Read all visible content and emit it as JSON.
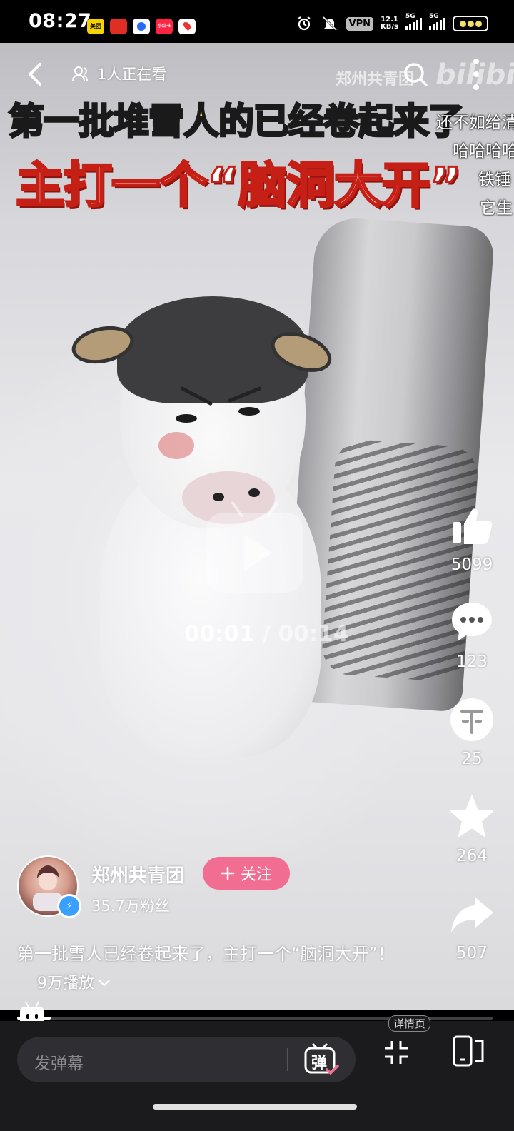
{
  "status_bar": {
    "time": "08:27",
    "app_icons": [
      {
        "name": "meituan-icon",
        "color": "#f5d300",
        "label": "美团"
      },
      {
        "name": "pinduoduo-icon",
        "color": "#e02e24",
        "label": ""
      },
      {
        "name": "browser-icon",
        "color": "#ffffff",
        "label": ""
      },
      {
        "name": "xiaohongshu-icon",
        "color": "#ff2442",
        "label": "小红书"
      },
      {
        "name": "map-icon",
        "color": "#ffffff",
        "label": ""
      }
    ],
    "vpn_label": "VPN",
    "net_speed_value": "12.1",
    "net_speed_unit": "KB/s",
    "signal1_label": "5G",
    "signal2_label": "5G"
  },
  "top": {
    "viewers_text": "1人正在看",
    "watermark_text": "郑州共青团",
    "logo_text": "bilibili"
  },
  "video": {
    "headline_line1": "第一批堆雪人的已经卷起来了",
    "headline_line2": "主打一个“脑洞大开”",
    "danmaku": [
      "还不如给清",
      "哈哈哈哈",
      "铁锤",
      "它生"
    ],
    "time_current": "00:01",
    "time_separator": "/",
    "time_total": "00:14",
    "progress_fraction": 0.07
  },
  "actions": {
    "like_count": "5099",
    "comment_count": "123",
    "coin_count": "25",
    "favorite_count": "264",
    "share_count": "507"
  },
  "author": {
    "name": "郑州共青团",
    "followers": "35.7万粉丝",
    "follow_label": "关注"
  },
  "description": {
    "text": "第一批雪人已经卷起来了，主打一个“脑洞大开”！",
    "plays": "9万播放"
  },
  "bottom": {
    "danmu_placeholder": "发弹幕",
    "danmu_toggle_label": "弹",
    "detail_label": "详情页"
  },
  "colors": {
    "follow_button": "#f26d92",
    "headline_yellow": "#ffe54a",
    "headline_red": "#c61f16",
    "verified_blue": "#3aa0ff"
  }
}
